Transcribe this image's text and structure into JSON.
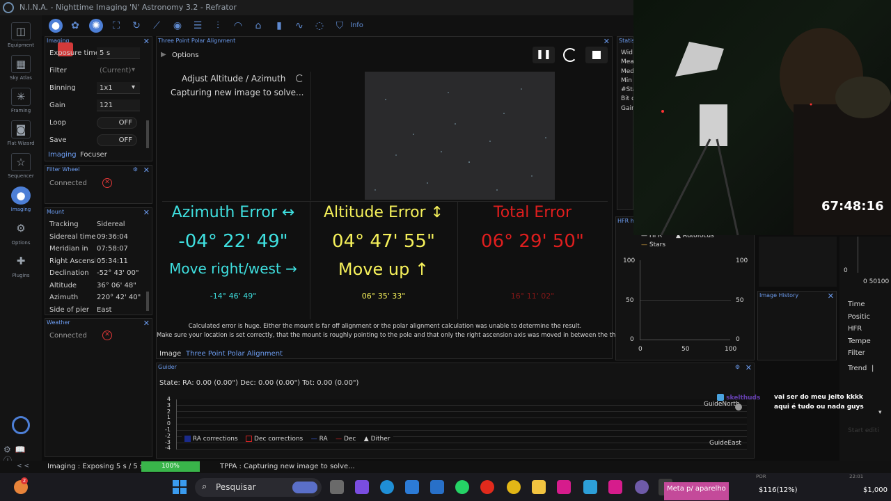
{
  "app": {
    "title": "N.I.N.A. - Nighttime Imaging 'N' Astronomy 3.2  -  Refrator"
  },
  "nav": {
    "items": [
      {
        "label": "Equipment",
        "icon": "camera-icon",
        "glyph": "◫"
      },
      {
        "label": "Sky Atlas",
        "icon": "map-icon",
        "glyph": "▦"
      },
      {
        "label": "Framing",
        "icon": "framing-icon",
        "glyph": "✳"
      },
      {
        "label": "Flat Wizard",
        "icon": "flat-icon",
        "glyph": "◙"
      },
      {
        "label": "Sequencer",
        "icon": "sequencer-icon",
        "glyph": "☆"
      },
      {
        "label": "Imaging",
        "icon": "imaging-icon",
        "glyph": "●"
      },
      {
        "label": "Options",
        "icon": "gear-icon",
        "glyph": "⚙"
      },
      {
        "label": "Plugins",
        "icon": "puzzle-icon",
        "glyph": "✚"
      }
    ],
    "bottom_glyphs": [
      "⚙",
      "📖",
      "ⓘ"
    ],
    "collapse": "< <"
  },
  "toolbar": {
    "info_label": "Info"
  },
  "imaging_panel": {
    "title": "Imaging",
    "rows": [
      {
        "label": "Exposure time",
        "value": "5",
        "unit": "s"
      },
      {
        "label": "Filter",
        "value": "(Current)"
      },
      {
        "label": "Binning",
        "value": "1x1"
      },
      {
        "label": "Gain",
        "value": "121"
      },
      {
        "label": "Loop",
        "value": "OFF"
      },
      {
        "label": "Save",
        "value": "OFF"
      }
    ],
    "tabs": [
      "Imaging",
      "Focuser"
    ]
  },
  "filter_wheel": {
    "title": "Filter Wheel",
    "status": "Connected"
  },
  "mount": {
    "title": "Mount",
    "rows": [
      {
        "label": "Tracking",
        "value": "Sidereal"
      },
      {
        "label": "Sidereal time",
        "value": "09:36:04"
      },
      {
        "label": "Meridian in",
        "value": "07:58:07"
      },
      {
        "label": "Right Ascension",
        "value": "05:34:11"
      },
      {
        "label": "Declination",
        "value": "-52° 43' 00\""
      },
      {
        "label": "Altitude",
        "value": "36° 06' 48\""
      },
      {
        "label": "Azimuth",
        "value": "220° 42' 40\""
      },
      {
        "label": "Side of pier",
        "value": "East"
      }
    ]
  },
  "weather": {
    "title": "Weather",
    "status": "Connected"
  },
  "tppa": {
    "title": "Three Point Polar Alignment",
    "options_label": "Options",
    "step_title": "Adjust Altitude / Azimuth",
    "step_status": "Capturing new image to solve...",
    "azimuth": {
      "title": "Azimuth Error ↔",
      "value": "-04° 22' 49\"",
      "move": "Move right/west →",
      "detail": "-14° 46' 49\""
    },
    "altitude": {
      "title": "Altitude Error ↕",
      "value": "04° 47' 55\"",
      "move": "Move up ↑",
      "detail": "06° 35' 33\""
    },
    "total": {
      "title": "Total Error",
      "value": "06° 29' 50\"",
      "detail": "16° 11' 02\""
    },
    "warning_line1": "Calculated error is huge. Either the mount is far off alignment or the polar alignment calculation was unable to determine the result.",
    "warning_line2": "Make sure your location is set correctly, that the mount is roughly pointing to the pole and that only the right ascension axis was moved in between the three points!",
    "tabs": [
      "Image",
      "Three Point Polar Alignment"
    ]
  },
  "statistics": {
    "title": "Statist",
    "labels": [
      "Wid",
      "Mea",
      "Med",
      "Min",
      "#Sta",
      "Bit d",
      "Gain"
    ]
  },
  "hfr": {
    "title": "HFR h",
    "legend": [
      "HFR",
      "Autofocus",
      "Stars"
    ],
    "y_ticks": [
      "100",
      "50",
      "0"
    ],
    "x_ticks": [
      "0",
      "50",
      "100"
    ]
  },
  "image_history": {
    "title": "Image History",
    "fields": [
      "Time",
      "Positic",
      "HFR",
      "Tempe",
      "Filter",
      "Trend"
    ],
    "trend_value": "|",
    "y_tick": "0",
    "x_ticks": "0 50100"
  },
  "guider": {
    "title": "Guider",
    "state": "State:  RA: 0.00 (0.00\")  Dec: 0.00 (0.00\")  Tot: 0.00 (0.00\")",
    "y_ticks": [
      "4",
      "3",
      "2",
      "1",
      "0",
      "-1",
      "-2",
      "-3",
      "-4"
    ],
    "north": "GuideNorth",
    "east": "GuideEast",
    "legend": [
      "RA corrections",
      "Dec corrections",
      "RA",
      "Dec",
      "Dither"
    ]
  },
  "webcam": {
    "timer": "67:48:16"
  },
  "chat": {
    "lines": [
      {
        "user": "skelthuds",
        "text": "vai ser do meu jeito kkkk"
      },
      {
        "user": "",
        "text": "aqui é tudo ou nada guys"
      }
    ],
    "faded": "Start editi"
  },
  "statusbar": {
    "collapse": "< <",
    "imaging": "Imaging :   Exposing 5 s / 5 s",
    "progress": 100,
    "progress_label": "100%",
    "tppa": "TPPA :   Capturing new image to solve..."
  },
  "taskbar": {
    "search_placeholder": "Pesquisar",
    "notification_badge": "2",
    "stream_label": "Meta p/ aparelho",
    "money_left": "$116(12%)",
    "money_right": "$1,000",
    "cut_top_left": "POR",
    "cut_top_right": "22:01"
  },
  "colors": {
    "accent": "#4d7fd6",
    "cyan": "#3fe0e0",
    "yellow": "#f5f05a",
    "red": "#e01e1e",
    "green": "#39b54a"
  }
}
